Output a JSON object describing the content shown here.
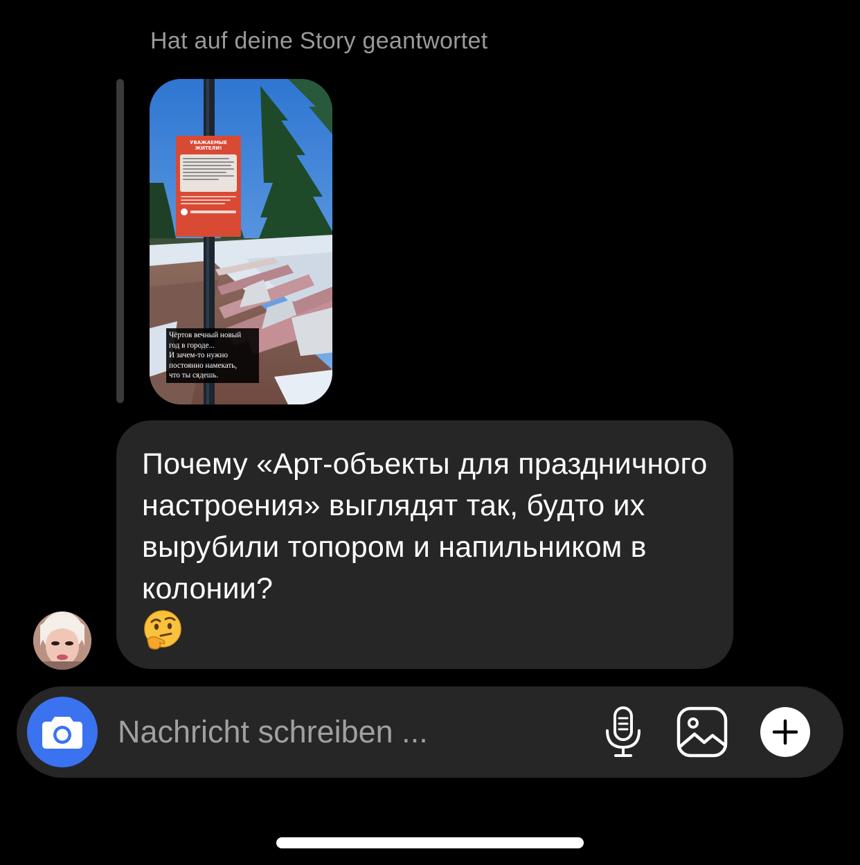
{
  "conversation": {
    "reply_caption": "Hat auf deine Story geantwortet",
    "story": {
      "sign_title": "УВАЖАЕМЫЕ ЖИТЕЛИ!",
      "caption": "Чёртов вечный новый\nгод в городе...\nИ зачем-то нужно\nпостоянно намекать,\nчто ты сядешь."
    },
    "message": {
      "text": "Почему «Арт-объекты для праздничного настроения» выглядят так, будто их вырубили топором и напильником в колонии?",
      "emoji": "thinking-face"
    }
  },
  "composer": {
    "placeholder": "Nachricht schreiben ...",
    "value": "",
    "camera_icon": "camera-icon",
    "mic_icon": "microphone-icon",
    "gallery_icon": "gallery-icon",
    "plus_icon": "plus-icon",
    "camera_color": "#3a72f0"
  }
}
